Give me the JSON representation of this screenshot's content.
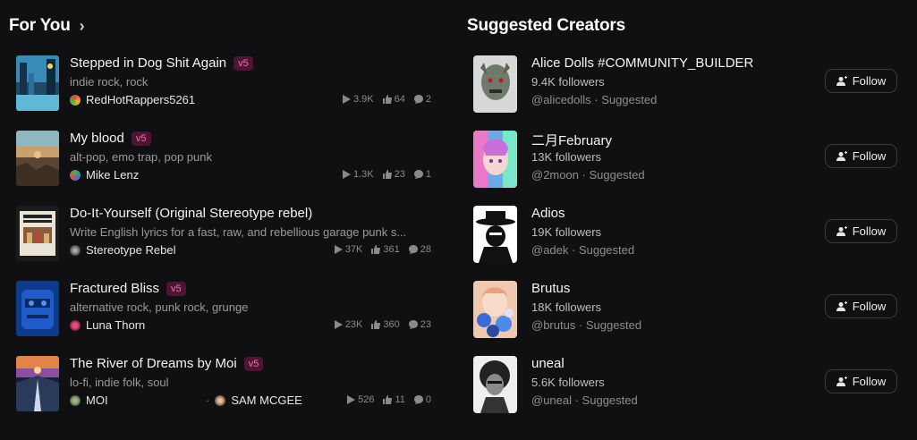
{
  "for_you": {
    "title": "For You",
    "songs": [
      {
        "title": "Stepped in Dog Shit Again",
        "badge": "v5",
        "tags": "indie rock, rock",
        "artist": "RedHotRappers5261",
        "plays": "3.9K",
        "likes": "64",
        "comments": "2"
      },
      {
        "title": "My blood",
        "badge": "v5",
        "tags": "alt-pop, emo trap, pop punk",
        "artist": "Mike Lenz",
        "plays": "1.3K",
        "likes": "23",
        "comments": "1"
      },
      {
        "title": "Do-It-Yourself (Original Stereotype rebel)",
        "badge": "",
        "tags": "Write English lyrics for a fast, raw, and rebellious garage punk s...",
        "artist": "Stereotype Rebel",
        "plays": "37K",
        "likes": "361",
        "comments": "28"
      },
      {
        "title": "Fractured Bliss",
        "badge": "v5",
        "tags": "alternative rock, punk rock, grunge",
        "artist": "Luna Thorn",
        "plays": "23K",
        "likes": "360",
        "comments": "23"
      },
      {
        "title": "The River of Dreams by Moi",
        "badge": "v5",
        "tags": "lo-fi, indie folk, soul",
        "artist": "MOI",
        "artist2": "SAM MCGEE",
        "plays": "526",
        "likes": "11",
        "comments": "0"
      }
    ]
  },
  "creators": {
    "title": "Suggested Creators",
    "follow_label": "Follow",
    "items": [
      {
        "name": "Alice Dolls #COMMUNITY_BUILDER",
        "followers": "9.4K followers",
        "handle": "@alicedolls · Suggested"
      },
      {
        "name": "二月February",
        "followers": "13K followers",
        "handle": "@2moon · Suggested"
      },
      {
        "name": "Adios",
        "followers": "19K followers",
        "handle": "@adek · Suggested"
      },
      {
        "name": "Brutus",
        "followers": "18K followers",
        "handle": "@brutus · Suggested"
      },
      {
        "name": "uneal",
        "followers": "5.6K followers",
        "handle": "@uneal · Suggested"
      }
    ]
  },
  "colors": {
    "badge_text": "#e879a8",
    "badge_bg": "#4d1433",
    "background": "#101012"
  },
  "icons": {
    "play": "play-icon",
    "like": "thumbs-up-icon",
    "comment": "comment-icon",
    "follow": "add-user-icon",
    "chevron": "chevron-right-icon"
  }
}
